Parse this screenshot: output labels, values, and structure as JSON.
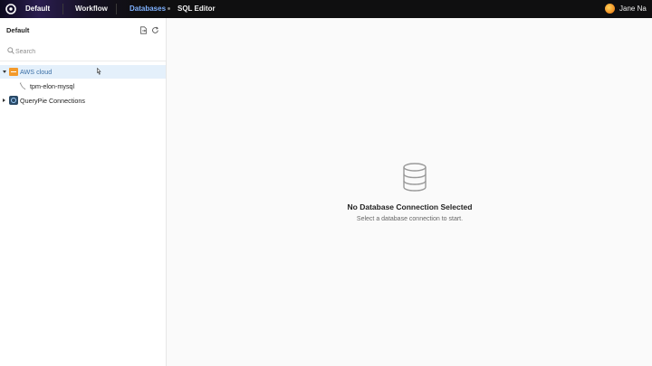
{
  "topbar": {
    "workspace": "Default",
    "nav": [
      "Workflow",
      "Databases",
      "SQL Editor"
    ],
    "active_nav": "Databases",
    "user_name": "Jane Na"
  },
  "sidebar": {
    "title": "Default",
    "search_placeholder": "Search",
    "tree": [
      {
        "label": "AWS cloud",
        "icon": "aws-icon",
        "expanded": true,
        "selected": true,
        "children": [
          {
            "label": "tpm-elon-mysql",
            "icon": "database-leaf-icon"
          }
        ]
      },
      {
        "label": "QueryPie Connections",
        "icon": "querypie-icon",
        "expanded": false,
        "selected": false
      }
    ]
  },
  "main": {
    "empty_icon": "database-icon",
    "empty_title": "No Database Connection Selected",
    "empty_subtitle": "Select a database connection to start."
  },
  "colors": {
    "accent": "#7fb2ff",
    "selected_row": "#e4f0fb",
    "aws": "#f39a2b",
    "topbar": "#0f0f10"
  }
}
